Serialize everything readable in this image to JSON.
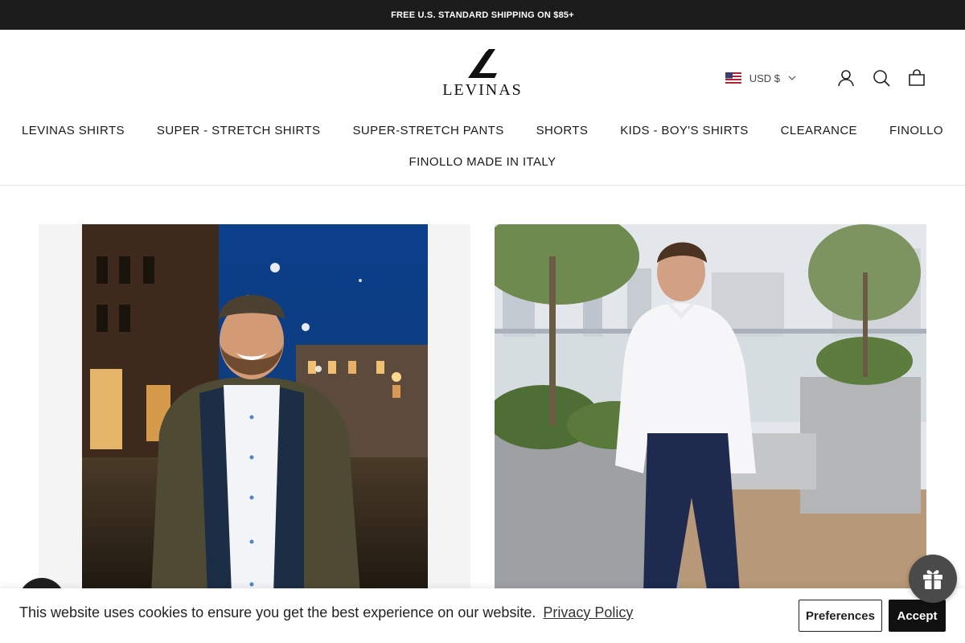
{
  "announcement": {
    "text": "FREE U.S. STANDARD SHIPPING ON $85+"
  },
  "brand": {
    "name": "LEVINAS"
  },
  "header": {
    "currency_label": "USD $",
    "icons": [
      "flag-us-icon",
      "chevron-down-icon",
      "account-icon",
      "search-icon",
      "cart-icon"
    ]
  },
  "nav": {
    "items": [
      {
        "label": "LEVINAS SHIRTS"
      },
      {
        "label": "SUPER - STRETCH SHIRTS"
      },
      {
        "label": "SUPER-STRETCH PANTS"
      },
      {
        "label": "SHORTS"
      },
      {
        "label": "KIDS - BOY'S SHIRTS"
      },
      {
        "label": "CLEARANCE"
      },
      {
        "label": "FINOLLO"
      },
      {
        "label": "FINOLLO MADE IN ITALY"
      }
    ]
  },
  "cookie_bar": {
    "message": "This website uses cookies to ensure you get the best experience on our website.",
    "link_label": "Privacy Policy",
    "preferences_label": "Preferences",
    "accept_label": "Accept"
  },
  "colors": {
    "announcement_bg": "#1c1c1c",
    "accent_dark": "#111111",
    "night_sky": "#0b3f8c"
  }
}
